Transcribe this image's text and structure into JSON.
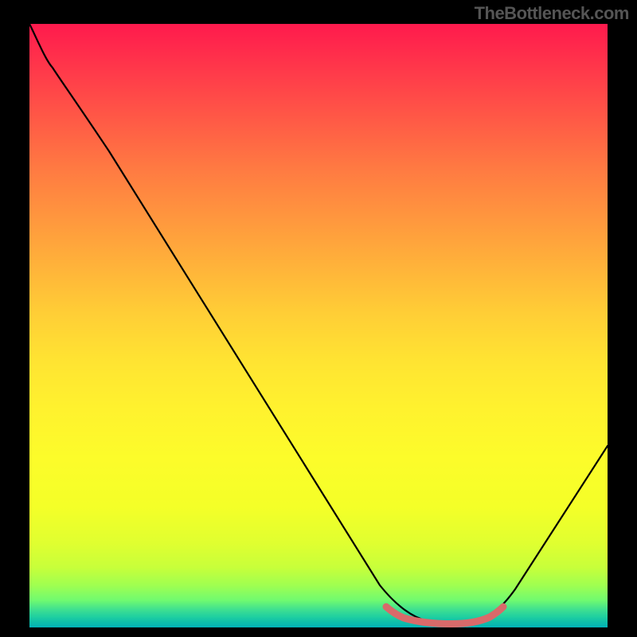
{
  "watermark": "TheBottleneck.com",
  "chart_data": {
    "type": "line",
    "title": "",
    "xlabel": "",
    "ylabel": "",
    "xlim": [
      0,
      100
    ],
    "ylim": [
      0,
      100
    ],
    "series": [
      {
        "name": "bottleneck-curve",
        "x": [
          0,
          4,
          10,
          20,
          30,
          40,
          50,
          58,
          62,
          66,
          70,
          74,
          78,
          84,
          92,
          100
        ],
        "y": [
          100,
          95,
          88,
          75,
          62,
          49,
          36,
          20,
          10,
          3,
          0.5,
          0,
          0.5,
          3,
          14,
          30
        ]
      },
      {
        "name": "optimal-range-highlight",
        "x": [
          62,
          66,
          70,
          74,
          78,
          80
        ],
        "y": [
          2.2,
          1.2,
          0.8,
          0.8,
          1.2,
          2.2
        ]
      }
    ],
    "gradient_stops": [
      {
        "pos": 0,
        "color": "#ff1a4d"
      },
      {
        "pos": 50,
        "color": "#ffce36"
      },
      {
        "pos": 80,
        "color": "#f4ff28"
      },
      {
        "pos": 100,
        "color": "#00b0b8"
      }
    ],
    "highlight_color": "#d96a6a"
  }
}
